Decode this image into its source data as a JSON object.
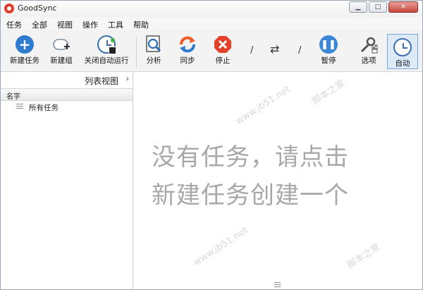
{
  "window": {
    "title": "GoodSync"
  },
  "menu": [
    "任务",
    "全部",
    "视图",
    "操作",
    "工具",
    "帮助"
  ],
  "toolbar": {
    "new_job": "新建任务",
    "new_group": "新建组",
    "disable_auto": "关闭自动运行",
    "analyze": "分析",
    "sync": "同步",
    "stop": "停止",
    "slash_left": "/",
    "slash_right": "/",
    "pause": "暂停",
    "options": "选项",
    "auto": "自动"
  },
  "left_panel": {
    "list_view": "列表视图",
    "column_name": "名字",
    "all_jobs": "所有任务"
  },
  "main": {
    "empty_line1": "没有任务，请点击",
    "empty_line2": "新建任务创建一个"
  },
  "watermark": "www.jb51.net",
  "watermark_cn": "脚本之家",
  "colors": {
    "blue": "#2f7bd0",
    "orange": "#ef5a28",
    "empty_text": "#a8a8a8"
  }
}
